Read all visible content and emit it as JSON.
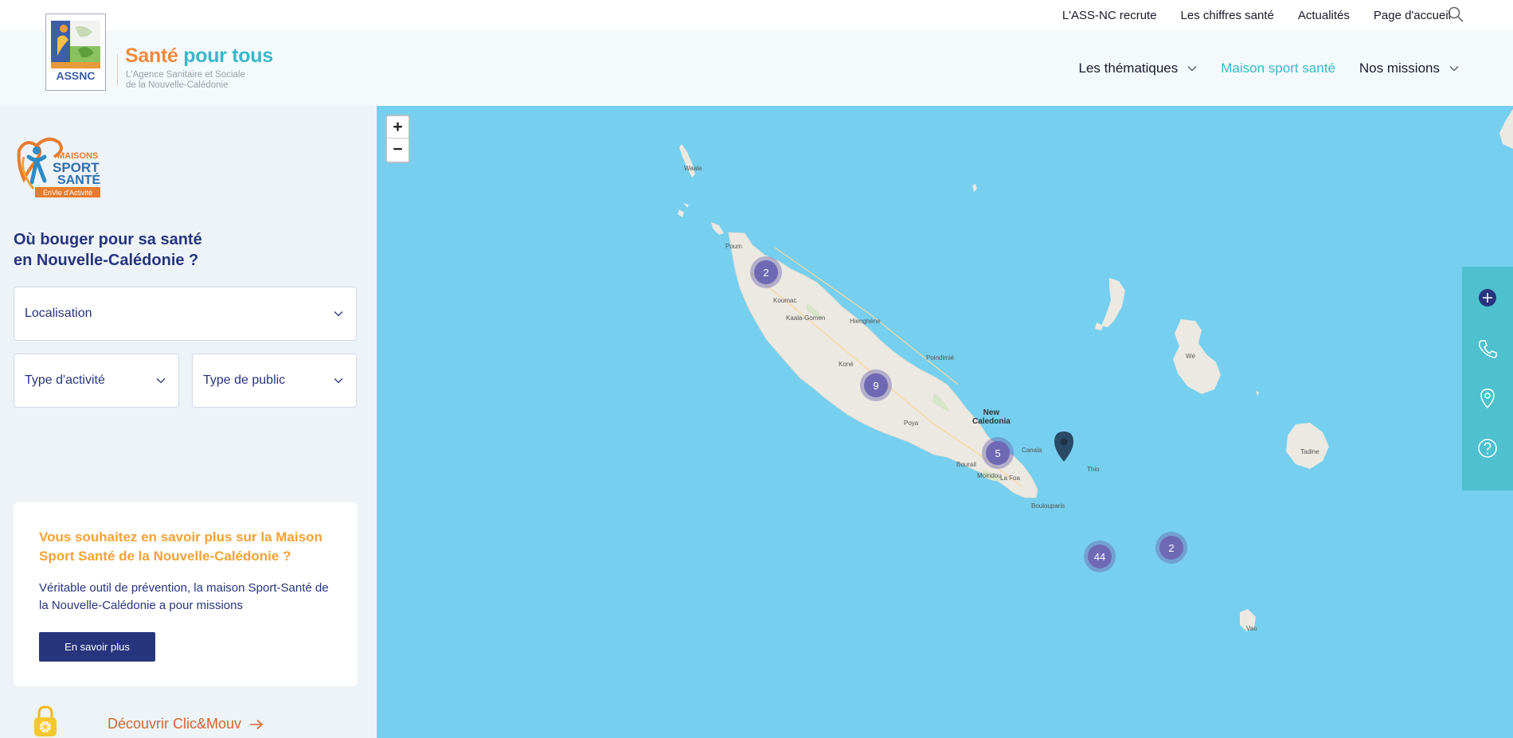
{
  "util_nav": {
    "links": [
      "L'ASS-NC recrute",
      "Les chiffres santé",
      "Actualités",
      "Page d'accueil"
    ],
    "search_icon": "search-icon"
  },
  "header": {
    "logo_text": "ASSNC",
    "brand_title_part1": "Santé",
    "brand_title_part2": "pour tous",
    "brand_sub_line1": "L'Agence Sanitaire et Sociale",
    "brand_sub_line2": "de la Nouvelle-Calédonie",
    "nav": [
      {
        "label": "Les thématiques",
        "has_dropdown": true,
        "active": false
      },
      {
        "label": "Maison sport santé",
        "has_dropdown": false,
        "active": true
      },
      {
        "label": "Nos missions",
        "has_dropdown": true,
        "active": false
      }
    ]
  },
  "left": {
    "msp_logo": {
      "line1": "MAISONS",
      "line2": "SPORT",
      "line3": "SANTÉ",
      "line4": "EnVie d'Activité"
    },
    "title_line1": "Où bouger pour sa santé",
    "title_line2": "en Nouvelle-Calédonie ?",
    "filters": {
      "localisation": "Localisation",
      "activite": "Type d'activité",
      "public": "Type de public"
    },
    "card": {
      "title": "Vous souhaitez en savoir plus sur la Maison Sport Santé de la Nouvelle-Calédonie ?",
      "text": "Véritable outil de prévention, la maison Sport-Santé de la Nouvelle-Calédonie a pour missions",
      "button": "En savoir plus"
    },
    "clic_link": "Découvrir Clic&Mouv"
  },
  "map": {
    "zoom_in": "+",
    "zoom_out": "−",
    "clusters": [
      {
        "count": "2"
      },
      {
        "count": "9"
      },
      {
        "count": "5"
      },
      {
        "count": "44"
      },
      {
        "count": "2"
      }
    ],
    "labels": {
      "new_caledonia_1": "New",
      "new_caledonia_2": "Caledonia",
      "koumac": "Koumac",
      "kaala": "Kaala-Gomen",
      "hienghene": "Hienghène",
      "poindimie": "Poindimié",
      "koné": "Koné",
      "poya": "Poya",
      "bourail": "Bourail",
      "la_foa": "La Foa",
      "moindou": "Moindou",
      "canala": "Canala",
      "boulouparis": "Boulouparis",
      "thio": "Thio",
      "wala": "Waala",
      "poum": "Poum",
      "we": "Wé",
      "tadine": "Tadine",
      "vao": "Vao"
    },
    "colors": {
      "sea": "#76cfee",
      "land": "#ece9e2",
      "cluster": "#6f68b3",
      "pin": "#2a4a66",
      "side_tabs": "#4ec0ce"
    },
    "side_tabs": [
      "plus-circle-icon",
      "phone-icon",
      "map-pin-icon",
      "help-circle-icon"
    ]
  }
}
